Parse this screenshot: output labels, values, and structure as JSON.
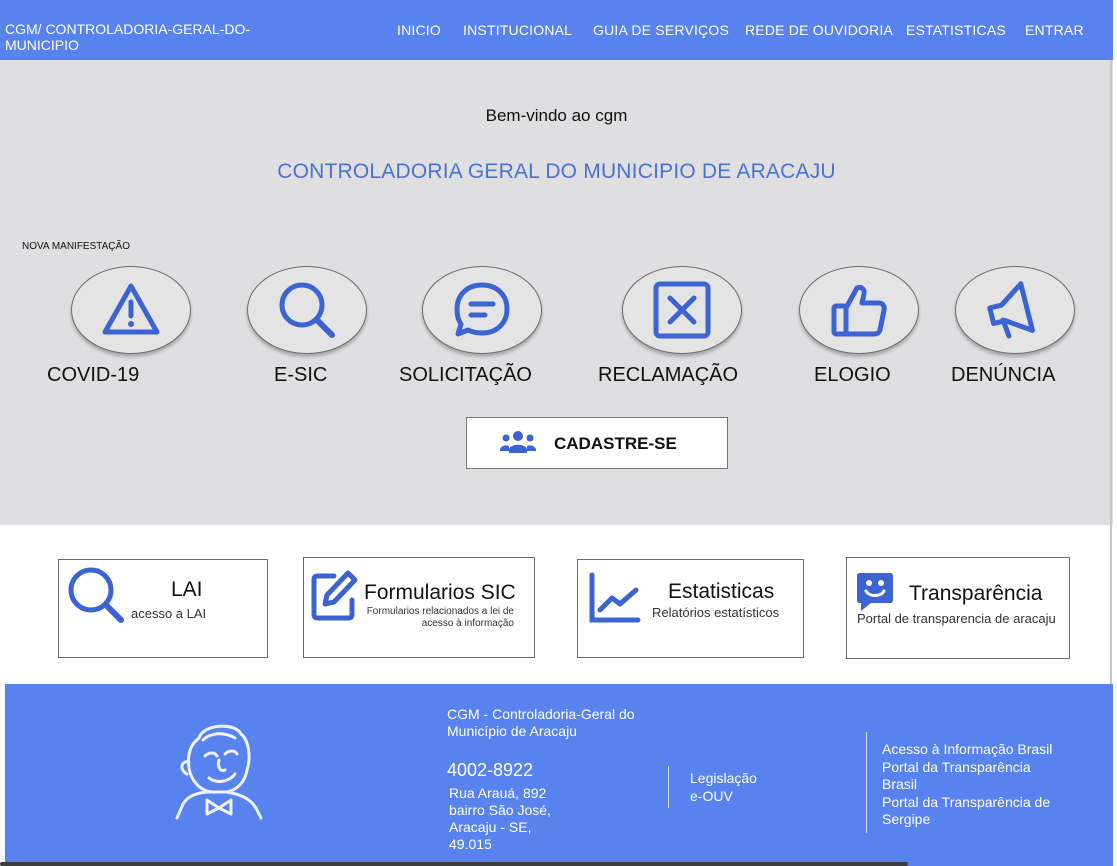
{
  "header": {
    "brand": "CGM/ CONTROLADORIA-GERAL-DO-MUNICIPIO",
    "nav": [
      "INICIO",
      "INSTITUCIONAL",
      "GUIA DE SERVIÇOS",
      "REDE DE OUVIDORIA",
      "ESTATISTICAS",
      "ENTRAR"
    ]
  },
  "hero": {
    "welcome": "Bem-vindo ao cgm",
    "title": "CONTROLADORIA GERAL DO MUNICIPIO DE ARACAJU",
    "section_label": "NOVA MANIFESTAÇÃO",
    "categories": [
      {
        "label": "COVID-19",
        "icon": "warning-triangle-icon"
      },
      {
        "label": "E-SIC",
        "icon": "search-icon"
      },
      {
        "label": "SOLICITAÇÃO",
        "icon": "chat-bubble-icon"
      },
      {
        "label": "RECLAMAÇÃO",
        "icon": "x-square-icon"
      },
      {
        "label": "ELOGIO",
        "icon": "thumbs-up-icon"
      },
      {
        "label": "DENÚNCIA",
        "icon": "megaphone-icon"
      }
    ],
    "register_button": "CADASTRE-SE",
    "register_icon": "users-icon"
  },
  "cards": [
    {
      "title": "LAI",
      "subtitle": "acesso a LAI",
      "icon": "search-icon"
    },
    {
      "title": "Formularios SIC",
      "subtitle": "Formularios relacionados a lei de acesso à informação",
      "icon": "edit-icon"
    },
    {
      "title": "Estatisticas",
      "subtitle": "Relatórios estatísticos",
      "icon": "line-chart-icon"
    },
    {
      "title": "Transparência",
      "subtitle": "Portal de transparencia de aracaju",
      "icon": "smile-chat-icon"
    }
  ],
  "footer": {
    "org_name": "CGM - Controladoria-Geral do Município de Aracaju",
    "phone": "4002-8922",
    "address": "Rua Arauá, 892 bairro São José, Aracaju - SE, 49.015",
    "links_middle": [
      "Legislação",
      "e-OUV"
    ],
    "links_right": [
      "Acesso à Informação Brasil",
      "Portal da Transparência Brasil",
      "Portal da Transparência de Sergipe"
    ],
    "logo_icon": "mascot-face-icon"
  },
  "colors": {
    "primary": "#5882ed",
    "icon_blue": "#3b63d1",
    "hero_bg": "#dfdee0"
  }
}
